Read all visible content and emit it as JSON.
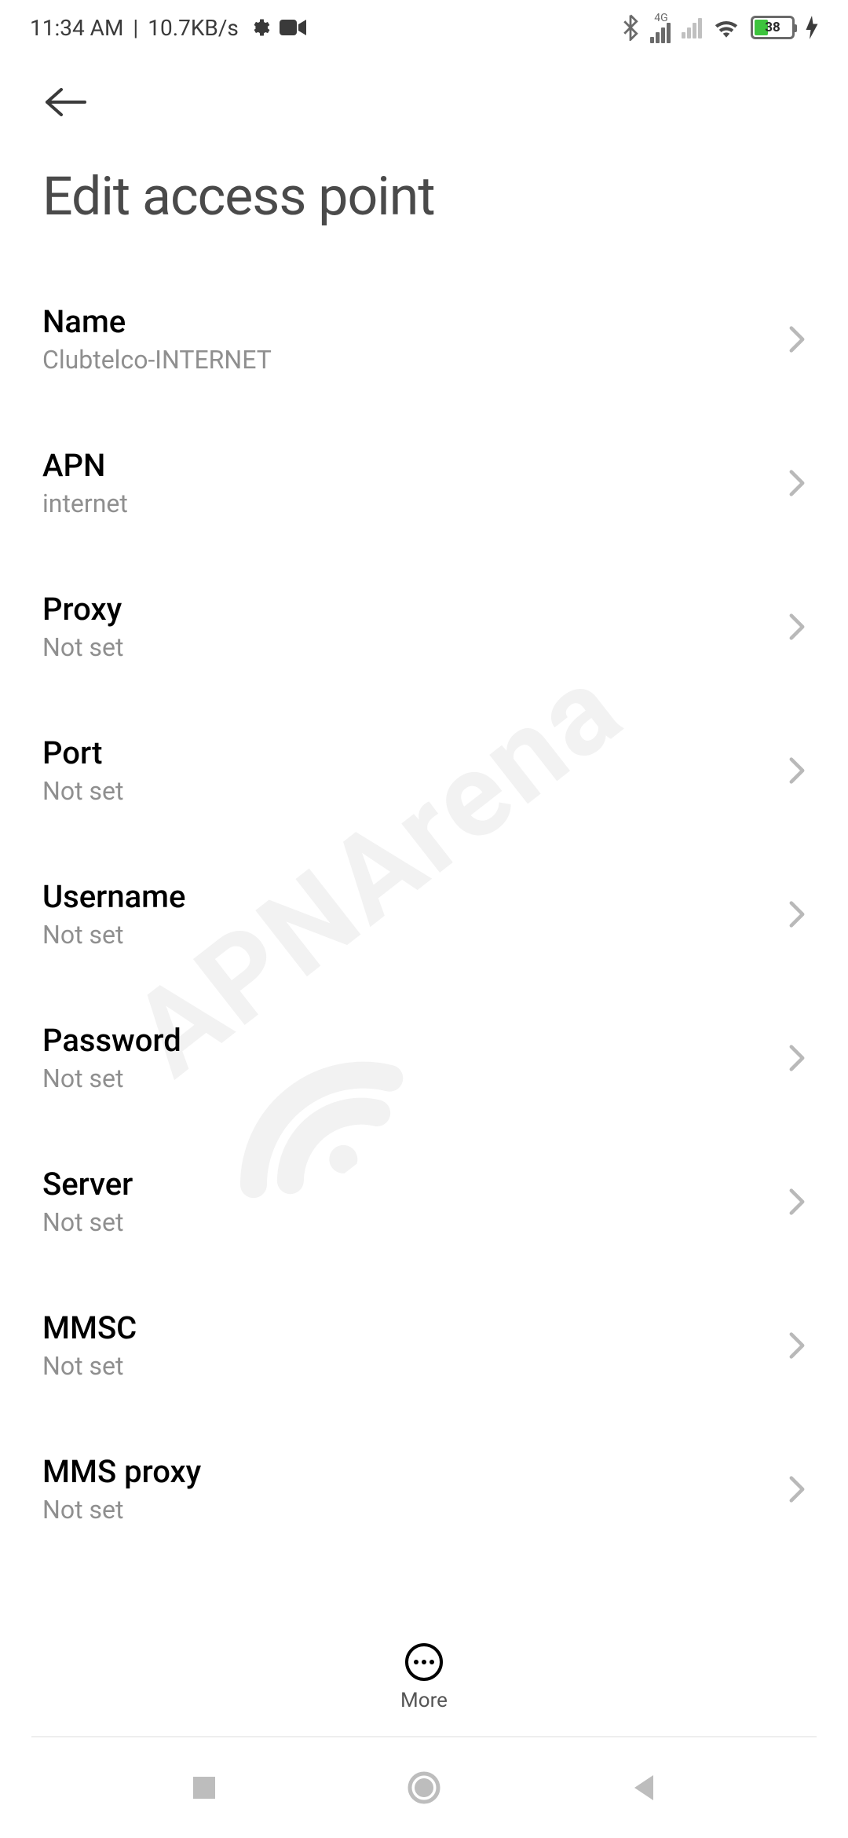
{
  "status": {
    "time": "11:34 AM",
    "separator": "|",
    "net_speed": "10.7KB/s",
    "signal_label": "4G",
    "battery_pct": "38"
  },
  "page": {
    "title": "Edit access point"
  },
  "settings": [
    {
      "label": "Name",
      "value": "Clubtelco-INTERNET"
    },
    {
      "label": "APN",
      "value": "internet"
    },
    {
      "label": "Proxy",
      "value": "Not set"
    },
    {
      "label": "Port",
      "value": "Not set"
    },
    {
      "label": "Username",
      "value": "Not set"
    },
    {
      "label": "Password",
      "value": "Not set"
    },
    {
      "label": "Server",
      "value": "Not set"
    },
    {
      "label": "MMSC",
      "value": "Not set"
    },
    {
      "label": "MMS proxy",
      "value": "Not set"
    }
  ],
  "toolbar": {
    "more_label": "More"
  },
  "watermark": {
    "text": "APNArena"
  }
}
